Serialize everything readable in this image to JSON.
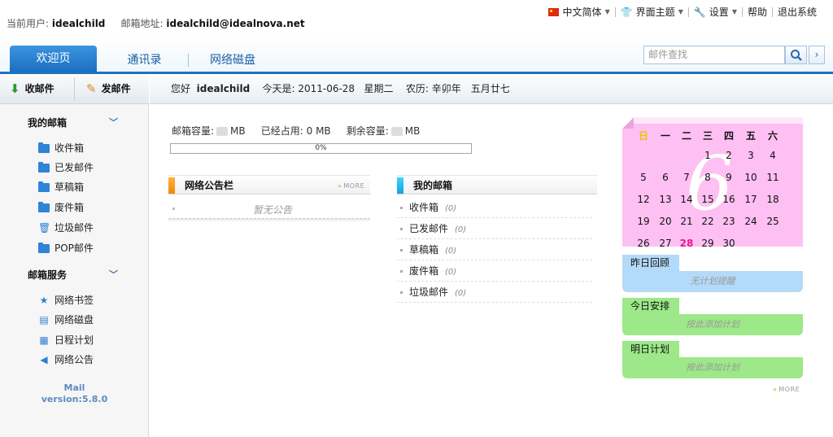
{
  "user": {
    "current_label": "当前用户:",
    "current_value": "idealchild",
    "email_label": "邮箱地址:",
    "email_value": "idealchild@idealnova.net"
  },
  "topnav": {
    "lang": "中文简体",
    "theme": "界面主题",
    "settings": "设置",
    "help": "帮助",
    "logout": "退出系统"
  },
  "tabs": [
    {
      "label": "欢迎页"
    },
    {
      "label": "通讯录"
    },
    {
      "label": "网络磁盘"
    }
  ],
  "search": {
    "placeholder": "邮件查找",
    "arrow": "›"
  },
  "actions": {
    "receive": "收邮件",
    "compose": "发邮件"
  },
  "greeting": {
    "hello": "您好",
    "user": "idealchild",
    "today_label": "今天是:",
    "date": "2011-06-28",
    "weekday": "星期二",
    "lunar_label": "农历:",
    "lunar": "辛卯年　五月廿七"
  },
  "sidebar": {
    "my_mailbox": "我的邮箱",
    "folders": [
      {
        "label": "收件箱"
      },
      {
        "label": "已发邮件"
      },
      {
        "label": "草稿箱"
      },
      {
        "label": "废件箱"
      },
      {
        "label": "垃圾邮件"
      },
      {
        "label": "POP邮件"
      }
    ],
    "services_title": "邮箱服务",
    "services": [
      {
        "label": "网络书签",
        "icon": "star-icon"
      },
      {
        "label": "网络磁盘",
        "icon": "disk-icon"
      },
      {
        "label": "日程计划",
        "icon": "calendar-icon"
      },
      {
        "label": "网络公告",
        "icon": "speaker-icon"
      }
    ],
    "version_line1": "Mail",
    "version_line2": "version:5.8.0"
  },
  "quota": {
    "capacity_label": "邮箱容量:",
    "unit1": "MB",
    "used_label": "已经占用:",
    "used_value": "0",
    "unit2": "MB",
    "remaining_label": "剩余容量:",
    "unit3": "MB",
    "progress": "0%",
    "progress_fraction": 0
  },
  "notice": {
    "title": "网络公告栏",
    "more": "MORE",
    "empty": "暂无公告"
  },
  "mybox": {
    "title": "我的邮箱",
    "rows": [
      {
        "label": "收件箱",
        "count": "(0)"
      },
      {
        "label": "已发邮件",
        "count": "(0)"
      },
      {
        "label": "草稿箱",
        "count": "(0)"
      },
      {
        "label": "废件箱",
        "count": "(0)"
      },
      {
        "label": "垃圾邮件",
        "count": "(0)"
      }
    ]
  },
  "calendar": {
    "month_display": "6",
    "weekdays": [
      "日",
      "一",
      "二",
      "三",
      "四",
      "五",
      "六"
    ],
    "days": [
      "",
      "",
      "",
      "1",
      "2",
      "3",
      "4",
      "5",
      "6",
      "7",
      "8",
      "9",
      "10",
      "11",
      "12",
      "13",
      "14",
      "15",
      "16",
      "17",
      "18",
      "19",
      "20",
      "21",
      "22",
      "23",
      "24",
      "25",
      "26",
      "27",
      "28",
      "29",
      "30",
      "",
      ""
    ],
    "today": "28"
  },
  "notes": [
    {
      "title": "昨日回顾",
      "body": "无计划提醒",
      "color": "#b3daf8"
    },
    {
      "title": "今日安排",
      "body": "按此添加计划",
      "color": "#9de889"
    },
    {
      "title": "明日计划",
      "body": "按此添加计划",
      "color": "#9de889"
    }
  ],
  "notes_more": "MORE"
}
